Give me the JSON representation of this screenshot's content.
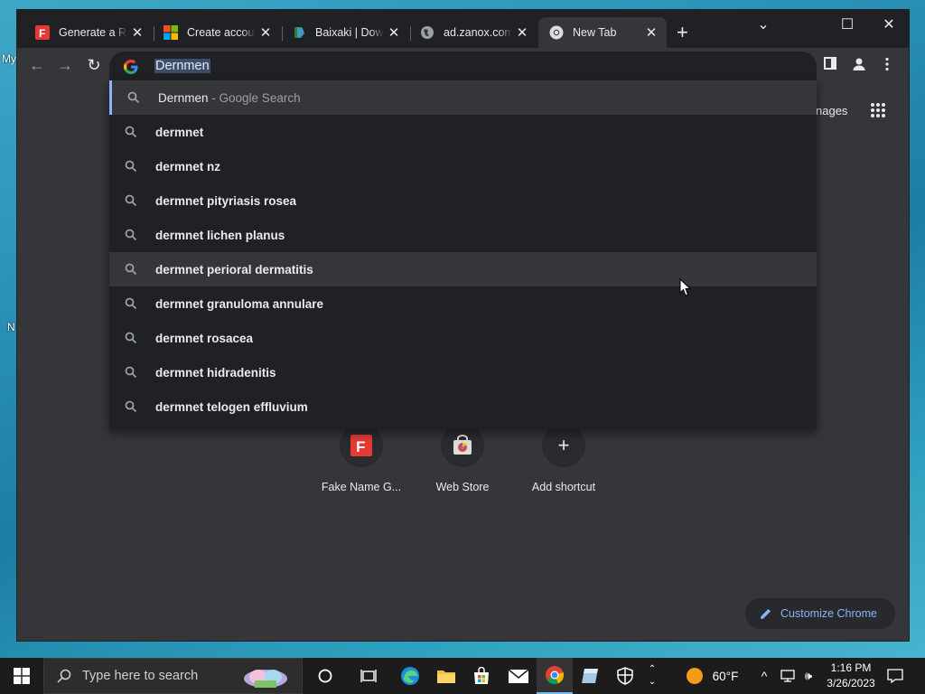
{
  "desktop": {
    "frag_top": "My",
    "frag_n": "N"
  },
  "tabs": [
    {
      "title": "Generate a Ra",
      "icon": "fakename-favicon-icon"
    },
    {
      "title": "Create accoun",
      "icon": "microsoft-favicon-icon"
    },
    {
      "title": "Baixaki | Down",
      "icon": "baixaki-favicon-icon"
    },
    {
      "title": "ad.zanox.com",
      "icon": "globe-icon"
    },
    {
      "title": "New Tab",
      "icon": "chrome-favicon-icon",
      "active": true
    }
  ],
  "omnibox": {
    "value": "Dernmen"
  },
  "suggestions": [
    {
      "text": "Dernmen",
      "desc": " - Google Search"
    },
    {
      "text": "dermnet"
    },
    {
      "text": "dermnet nz"
    },
    {
      "text": "dermnet pityriasis rosea"
    },
    {
      "text": "dermnet lichen planus"
    },
    {
      "text": "dermnet perioral dermatitis"
    },
    {
      "text": "dermnet granuloma annulare"
    },
    {
      "text": "dermnet rosacea"
    },
    {
      "text": "dermnet hidradenitis"
    },
    {
      "text": "dermnet telogen effluvium"
    }
  ],
  "ntp": {
    "images_partial": "nages",
    "shortcuts": [
      {
        "label": "Fake Name G...",
        "icon": "fakename-icon"
      },
      {
        "label": "Web Store",
        "icon": "webstore-icon"
      },
      {
        "label": "Add shortcut",
        "icon": "plus-icon"
      }
    ],
    "customize_label": "Customize Chrome"
  },
  "taskbar": {
    "search_placeholder": "Type here to search",
    "weather_temp": "60°F",
    "time": "1:16 PM",
    "date": "3/26/2023"
  },
  "colors": {
    "accent": "#8ab4f8",
    "tab_bg": "#202124",
    "surface": "#35363a"
  }
}
